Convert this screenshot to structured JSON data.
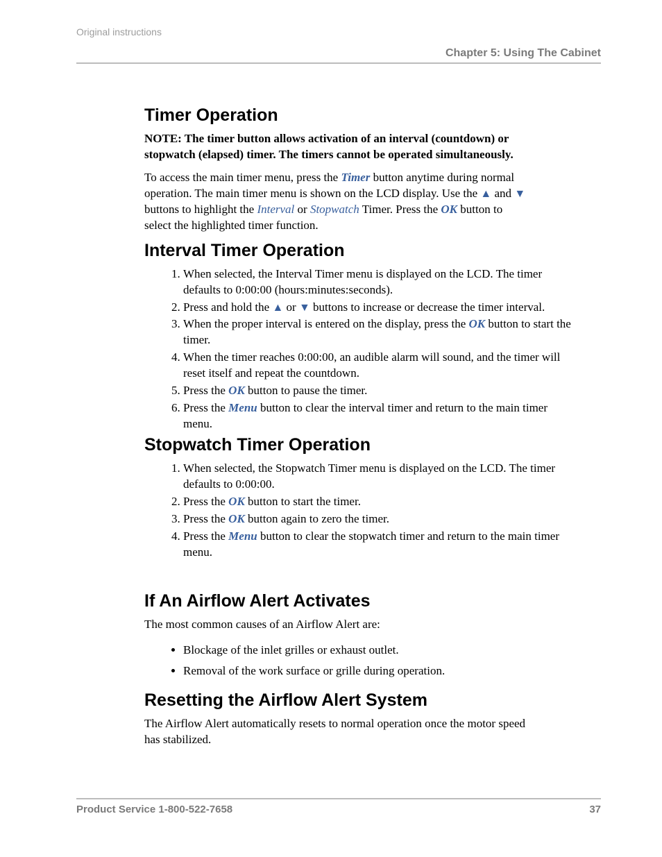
{
  "header": {
    "top_meta": "Original instructions",
    "chapter": "Chapter 5: Using The Cabinet"
  },
  "sections": {
    "timer_op": {
      "title": "Timer Operation",
      "note_run": {
        "lead": "NOTE:  ",
        "rest": "The timer button allows activation of an interval (countdown) or stopwatch (elapsed) timer.  The timers cannot be operated simultaneously."
      },
      "access": {
        "pre1": "To access the main timer menu, press the ",
        "timer": "Timer",
        "mid1": " button anytime during normal operation. The main timer menu is shown on the LCD display. Use the ",
        "up": "▲",
        "and": " and ",
        "down": "▼",
        "mid2": " buttons to highlight the ",
        "interval": "Interval",
        "or": " or ",
        "stopwatch": "Stopwatch",
        "mid3": " Timer. Press the ",
        "ok": "OK",
        "post": " button to select the highlighted timer function."
      }
    },
    "interval": {
      "title": "Interval Timer Operation",
      "items": {
        "i1": "When selected, the Interval Timer menu is displayed on the LCD. The timer defaults to 0:00:00 (hours:minutes:seconds).",
        "i2": {
          "pre": "Press and hold the ",
          "up": "▲",
          "or": " or ",
          "down": "▼",
          "post": " buttons to increase or decrease the timer interval."
        },
        "i3": {
          "pre": "When the proper interval is entered on the display, press the ",
          "ok": "OK",
          "post": " button to start the timer."
        },
        "i4": "When the timer reaches 0:00:00, an audible alarm will sound, and the timer will reset itself and repeat the countdown.",
        "i5": {
          "pre": "Press the ",
          "ok": "OK",
          "post": " button to pause the timer."
        },
        "i6": {
          "pre": "Press the ",
          "menu": "Menu",
          "post": " button to clear the interval timer and return to the main timer menu."
        }
      }
    },
    "stopwatch": {
      "title": "Stopwatch Timer Operation",
      "items": {
        "s1": "When selected, the Stopwatch Timer menu is displayed on the LCD. The timer defaults to 0:00:00.",
        "s2": {
          "pre": "Press the ",
          "ok": "OK",
          "post": " button to start the timer."
        },
        "s3": {
          "pre": "Press the ",
          "ok": "OK",
          "post": " button again to zero the timer."
        },
        "s4": {
          "pre": "Press the ",
          "menu": "Menu",
          "post": " button to clear the stopwatch timer and return to the main timer menu."
        }
      }
    },
    "airflow_alert": {
      "title": "If An Airflow Alert Activates",
      "intro": "The most common causes of an Airflow Alert are:",
      "bullets": {
        "b1": "Blockage of the inlet grilles or exhaust outlet.",
        "b2": "Removal of the work surface or grille during operation."
      }
    },
    "reset_alert": {
      "title": "Resetting the Airflow Alert System",
      "para": "The Airflow Alert automatically resets to normal operation once the motor speed has stabilized."
    }
  },
  "footer": {
    "service": "Product Service 1-800-522-7658",
    "page_number": "37"
  }
}
